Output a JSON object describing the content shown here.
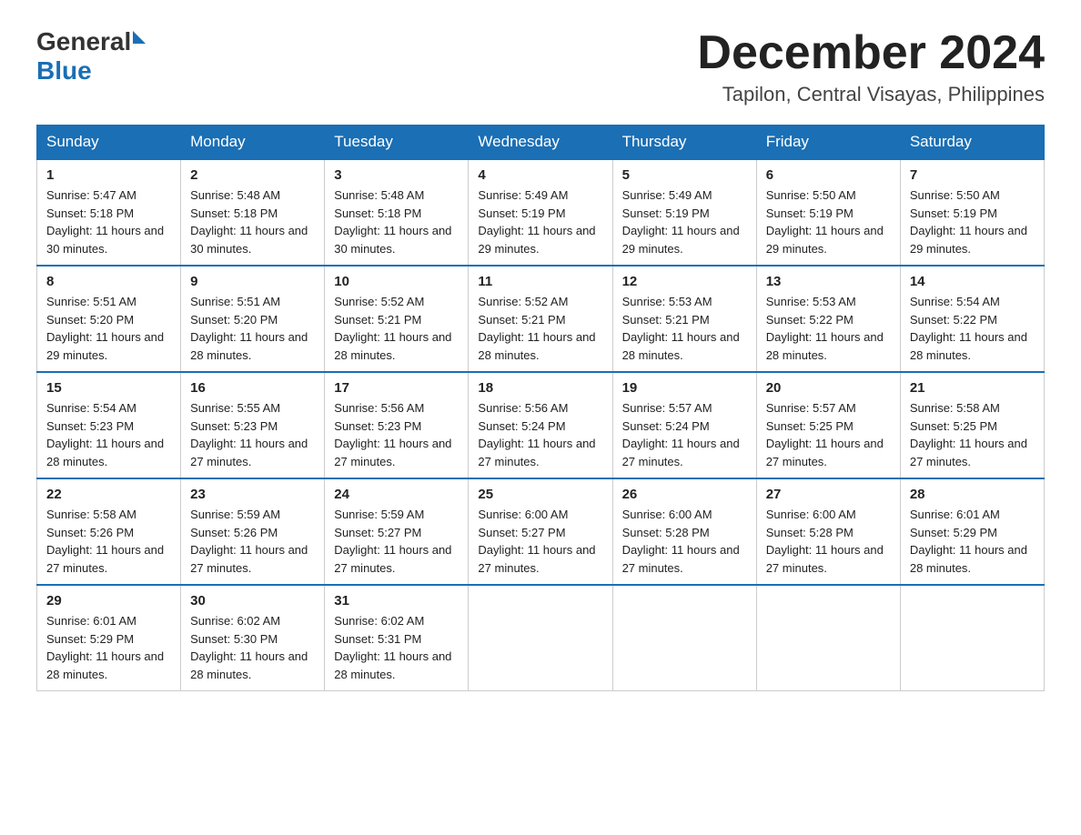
{
  "header": {
    "logo_general": "General",
    "logo_blue": "Blue",
    "month_year": "December 2024",
    "location": "Tapilon, Central Visayas, Philippines"
  },
  "weekdays": [
    "Sunday",
    "Monday",
    "Tuesday",
    "Wednesday",
    "Thursday",
    "Friday",
    "Saturday"
  ],
  "weeks": [
    [
      {
        "day": "1",
        "sunrise": "5:47 AM",
        "sunset": "5:18 PM",
        "daylight": "11 hours and 30 minutes."
      },
      {
        "day": "2",
        "sunrise": "5:48 AM",
        "sunset": "5:18 PM",
        "daylight": "11 hours and 30 minutes."
      },
      {
        "day": "3",
        "sunrise": "5:48 AM",
        "sunset": "5:18 PM",
        "daylight": "11 hours and 30 minutes."
      },
      {
        "day": "4",
        "sunrise": "5:49 AM",
        "sunset": "5:19 PM",
        "daylight": "11 hours and 29 minutes."
      },
      {
        "day": "5",
        "sunrise": "5:49 AM",
        "sunset": "5:19 PM",
        "daylight": "11 hours and 29 minutes."
      },
      {
        "day": "6",
        "sunrise": "5:50 AM",
        "sunset": "5:19 PM",
        "daylight": "11 hours and 29 minutes."
      },
      {
        "day": "7",
        "sunrise": "5:50 AM",
        "sunset": "5:19 PM",
        "daylight": "11 hours and 29 minutes."
      }
    ],
    [
      {
        "day": "8",
        "sunrise": "5:51 AM",
        "sunset": "5:20 PM",
        "daylight": "11 hours and 29 minutes."
      },
      {
        "day": "9",
        "sunrise": "5:51 AM",
        "sunset": "5:20 PM",
        "daylight": "11 hours and 28 minutes."
      },
      {
        "day": "10",
        "sunrise": "5:52 AM",
        "sunset": "5:21 PM",
        "daylight": "11 hours and 28 minutes."
      },
      {
        "day": "11",
        "sunrise": "5:52 AM",
        "sunset": "5:21 PM",
        "daylight": "11 hours and 28 minutes."
      },
      {
        "day": "12",
        "sunrise": "5:53 AM",
        "sunset": "5:21 PM",
        "daylight": "11 hours and 28 minutes."
      },
      {
        "day": "13",
        "sunrise": "5:53 AM",
        "sunset": "5:22 PM",
        "daylight": "11 hours and 28 minutes."
      },
      {
        "day": "14",
        "sunrise": "5:54 AM",
        "sunset": "5:22 PM",
        "daylight": "11 hours and 28 minutes."
      }
    ],
    [
      {
        "day": "15",
        "sunrise": "5:54 AM",
        "sunset": "5:23 PM",
        "daylight": "11 hours and 28 minutes."
      },
      {
        "day": "16",
        "sunrise": "5:55 AM",
        "sunset": "5:23 PM",
        "daylight": "11 hours and 27 minutes."
      },
      {
        "day": "17",
        "sunrise": "5:56 AM",
        "sunset": "5:23 PM",
        "daylight": "11 hours and 27 minutes."
      },
      {
        "day": "18",
        "sunrise": "5:56 AM",
        "sunset": "5:24 PM",
        "daylight": "11 hours and 27 minutes."
      },
      {
        "day": "19",
        "sunrise": "5:57 AM",
        "sunset": "5:24 PM",
        "daylight": "11 hours and 27 minutes."
      },
      {
        "day": "20",
        "sunrise": "5:57 AM",
        "sunset": "5:25 PM",
        "daylight": "11 hours and 27 minutes."
      },
      {
        "day": "21",
        "sunrise": "5:58 AM",
        "sunset": "5:25 PM",
        "daylight": "11 hours and 27 minutes."
      }
    ],
    [
      {
        "day": "22",
        "sunrise": "5:58 AM",
        "sunset": "5:26 PM",
        "daylight": "11 hours and 27 minutes."
      },
      {
        "day": "23",
        "sunrise": "5:59 AM",
        "sunset": "5:26 PM",
        "daylight": "11 hours and 27 minutes."
      },
      {
        "day": "24",
        "sunrise": "5:59 AM",
        "sunset": "5:27 PM",
        "daylight": "11 hours and 27 minutes."
      },
      {
        "day": "25",
        "sunrise": "6:00 AM",
        "sunset": "5:27 PM",
        "daylight": "11 hours and 27 minutes."
      },
      {
        "day": "26",
        "sunrise": "6:00 AM",
        "sunset": "5:28 PM",
        "daylight": "11 hours and 27 minutes."
      },
      {
        "day": "27",
        "sunrise": "6:00 AM",
        "sunset": "5:28 PM",
        "daylight": "11 hours and 27 minutes."
      },
      {
        "day": "28",
        "sunrise": "6:01 AM",
        "sunset": "5:29 PM",
        "daylight": "11 hours and 28 minutes."
      }
    ],
    [
      {
        "day": "29",
        "sunrise": "6:01 AM",
        "sunset": "5:29 PM",
        "daylight": "11 hours and 28 minutes."
      },
      {
        "day": "30",
        "sunrise": "6:02 AM",
        "sunset": "5:30 PM",
        "daylight": "11 hours and 28 minutes."
      },
      {
        "day": "31",
        "sunrise": "6:02 AM",
        "sunset": "5:31 PM",
        "daylight": "11 hours and 28 minutes."
      },
      null,
      null,
      null,
      null
    ]
  ]
}
